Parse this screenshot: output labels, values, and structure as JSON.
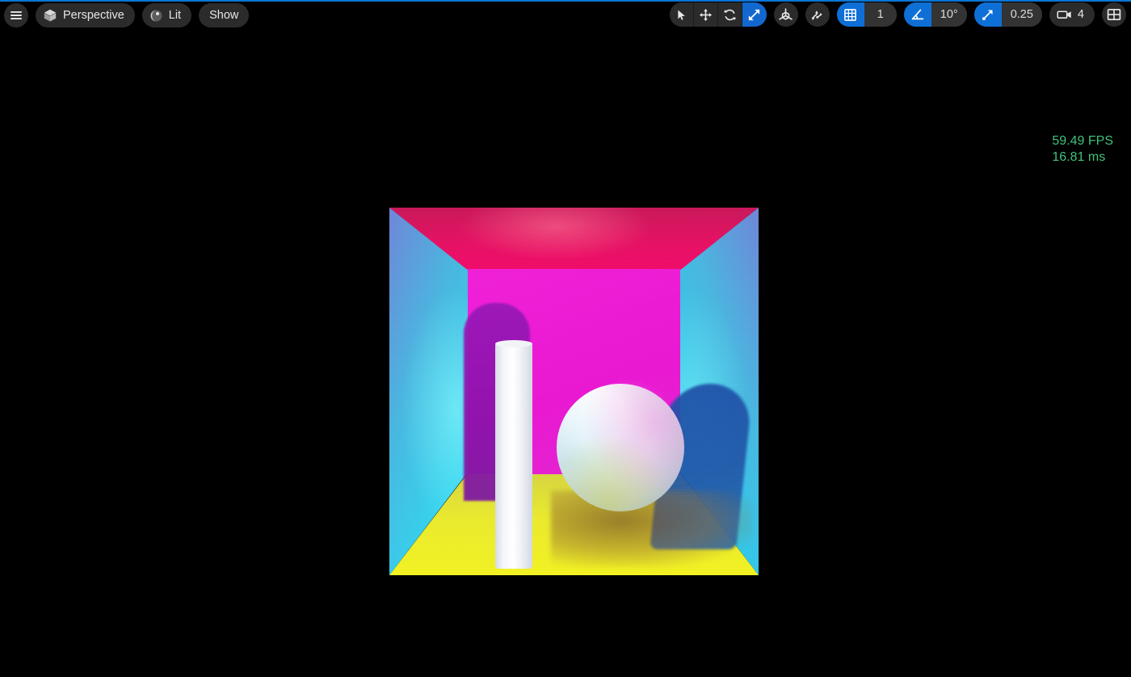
{
  "window": {
    "background_color": "#000000",
    "active_border_color": "#0b74d4"
  },
  "toolbar": {
    "menu_icon": "hamburger-menu-icon",
    "view_mode": {
      "label": "Perspective",
      "icon": "cube-icon"
    },
    "lighting_mode": {
      "label": "Lit",
      "icon": "shaded-sphere-icon"
    },
    "show_menu": {
      "label": "Show"
    },
    "transform_tools": [
      {
        "name": "select",
        "icon": "cursor-arrow-icon",
        "active": false
      },
      {
        "name": "move",
        "icon": "move-arrows-icon",
        "active": false
      },
      {
        "name": "rotate",
        "icon": "rotate-arrows-icon",
        "active": false
      },
      {
        "name": "scale",
        "icon": "scale-diagonal-arrows-icon",
        "active": true
      }
    ],
    "coordinate_system": {
      "name": "world-coordinates",
      "icon": "axis-gizmo-icon",
      "active": false
    },
    "surface_snap": {
      "name": "surface-snapping",
      "icon": "surface-snap-icon",
      "active": false
    },
    "grid_snap": {
      "icon": "grid-icon",
      "active": true,
      "value": "1"
    },
    "angle_snap": {
      "icon": "angle-icon",
      "active": true,
      "value": "10°"
    },
    "scale_snap": {
      "icon": "scale-arrow-icon",
      "active": true,
      "value": "0.25"
    },
    "camera_speed": {
      "icon": "camera-icon",
      "active": false,
      "value": "4"
    },
    "layout": {
      "icon": "four-pane-layout-icon",
      "active": false
    },
    "accent_color": "#0e6fd6",
    "pill_color": "#2b2b2b"
  },
  "stats": {
    "fps": "59.49 FPS",
    "frame_time": "16.81 ms",
    "color": "#41c27a"
  },
  "viewport": {
    "scene_name": "cornell-box-render",
    "objects": [
      "sphere",
      "cylinder",
      "area-light"
    ],
    "colors": {
      "back_wall": "#ea18d2",
      "ceiling": "#e51263",
      "floor": "#eaea2e",
      "left_wall": "#35d2ee",
      "right_wall": "#2fcbea",
      "sphere": "#ffffff",
      "cylinder": "#ffffff"
    }
  }
}
